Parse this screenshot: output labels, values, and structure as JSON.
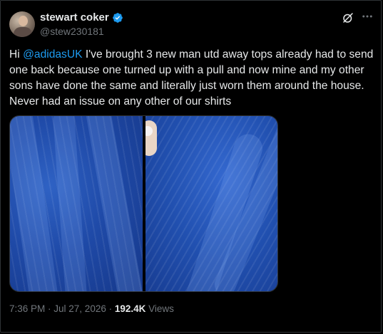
{
  "author": {
    "display_name": "stewart coker",
    "handle": "@stew230181",
    "verified": true
  },
  "tweet": {
    "greeting": "Hi ",
    "mention": "@adidasUK",
    "body": " I've brought 3 new man utd away tops already had to send one back because one turned up with a pull and now mine and my other sons have done the same and literally just worn them around the house. Never had an issue on any other of our shirts"
  },
  "media": {
    "images": [
      {
        "icon": "jersey-fabric-photo-left"
      },
      {
        "icon": "jersey-fabric-photo-right"
      }
    ]
  },
  "meta": {
    "time": "7:36 PM",
    "separator": " · ",
    "date": "Jul 27, 2026",
    "separator2": " · ",
    "views_count": "192.4K",
    "views_label": " Views"
  },
  "colors": {
    "accent": "#1d9bf0",
    "background": "#000000",
    "text": "#e7e9ea",
    "secondary": "#71767b"
  }
}
